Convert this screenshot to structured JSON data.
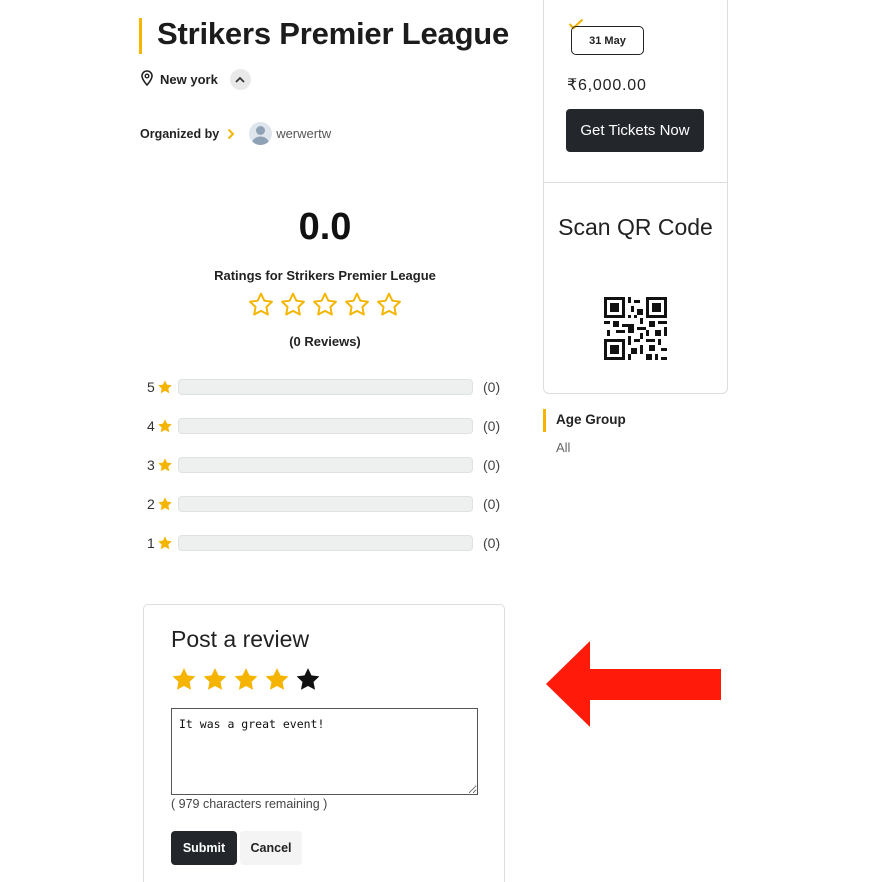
{
  "event": {
    "title": "Strikers Premier League",
    "location": "New york",
    "organized_by_label": "Organized by",
    "organizer_name": "werwertw"
  },
  "ratings": {
    "average": "0.0",
    "caption": "Ratings for Strikers Premier League",
    "reviews_count": "(0 Reviews)",
    "star_fill_fraction": 0,
    "breakdown": [
      {
        "stars": "5",
        "count": "(0)",
        "fraction": 0
      },
      {
        "stars": "4",
        "count": "(0)",
        "fraction": 0
      },
      {
        "stars": "3",
        "count": "(0)",
        "fraction": 0
      },
      {
        "stars": "2",
        "count": "(0)",
        "fraction": 0
      },
      {
        "stars": "1",
        "count": "(0)",
        "fraction": 0
      }
    ]
  },
  "sidebar": {
    "date": "31 May",
    "price": "₹6,000.00",
    "tickets_button": "Get Tickets Now",
    "qr_title": "Scan QR Code",
    "age_group_label": "Age Group",
    "age_group_value": "All"
  },
  "review_form": {
    "title": "Post a review",
    "selected_stars": 4,
    "text": "It was a great event!",
    "chars_remaining": "( 979 characters remaining )",
    "submit_label": "Submit",
    "cancel_label": "Cancel"
  },
  "colors": {
    "accent": "#f5b400",
    "dark": "#23272b",
    "arrow": "#ff1a0a"
  },
  "icons": {
    "location": "map-pin-icon",
    "chevron_up": "chevron-up-icon",
    "organizer_arrow": "chevron-right-icon",
    "avatar": "user-avatar-icon",
    "date_check": "checkmark-icon",
    "star": "star-icon",
    "qr": "qr-code-icon",
    "annotation": "red-arrow-left"
  }
}
